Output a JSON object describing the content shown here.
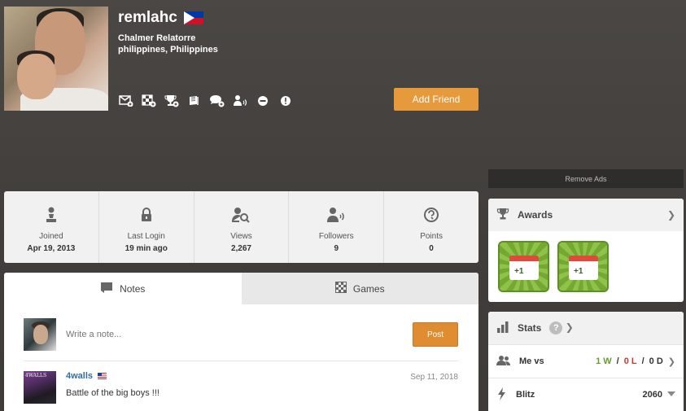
{
  "profile": {
    "username": "remlahc",
    "real_name": "Chalmer Relatorre",
    "location": "philippines, Philippines",
    "add_friend_label": "Add Friend"
  },
  "ads": {
    "remove_label": "Remove Ads"
  },
  "stats_bar": [
    {
      "label": "Joined",
      "value": "Apr 19, 2013",
      "icon": "pawn-icon"
    },
    {
      "label": "Last Login",
      "value": "19 min ago",
      "icon": "lock-icon"
    },
    {
      "label": "Views",
      "value": "2,267",
      "icon": "views-icon"
    },
    {
      "label": "Followers",
      "value": "9",
      "icon": "followers-icon"
    },
    {
      "label": "Points",
      "value": "0",
      "icon": "points-icon"
    }
  ],
  "tabs": [
    {
      "label": "Notes",
      "active": true
    },
    {
      "label": "Games",
      "active": false
    }
  ],
  "notes": {
    "placeholder": "Write a note...",
    "post_label": "Post",
    "items": [
      {
        "user": "4walls",
        "date": "Sep 11, 2018",
        "text": "Battle of the big boys !!!",
        "avatar_text": "4WALLS"
      }
    ]
  },
  "awards": {
    "title": "Awards",
    "badge_text": "+1"
  },
  "stats": {
    "title": "Stats",
    "help": "?",
    "me_vs_label": "Me vs",
    "wins": "1 W",
    "losses": "0 L",
    "draws": "0 D",
    "sep": "/",
    "blitz_label": "Blitz",
    "blitz_value": "2060"
  }
}
